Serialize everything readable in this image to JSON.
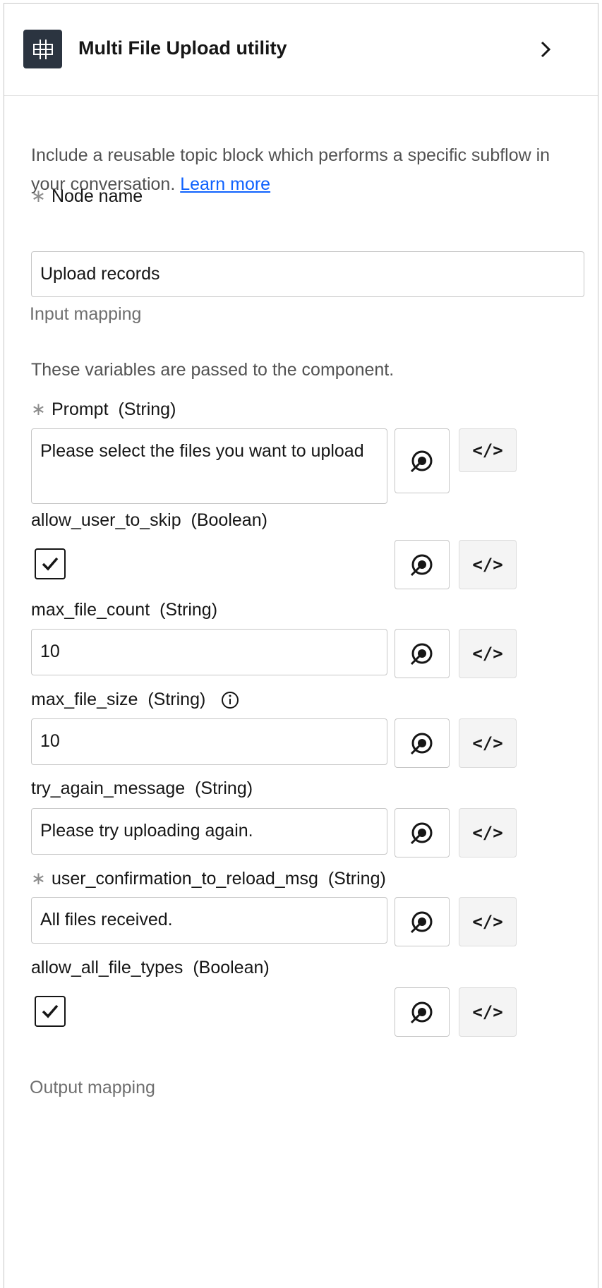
{
  "header": {
    "title": "Multi File Upload utility",
    "icon": "grid-plus-icon"
  },
  "description": {
    "text": "Include a reusable topic block which performs a specific subflow in your conversation.",
    "link": "Learn more"
  },
  "node_name": {
    "label": "Node name",
    "required_mark": "∗",
    "value": "Upload records"
  },
  "input_mapping": {
    "title": "Input mapping",
    "hint": "These variables are passed to the component.",
    "fields": [
      {
        "name": "Prompt",
        "type": "(String)",
        "required": true,
        "value": "Please select the files you want to upload"
      },
      {
        "name": "allow_user_to_skip",
        "type": "(Boolean)",
        "required": false,
        "checked": true
      },
      {
        "name": "max_file_count",
        "type": "(String)",
        "required": false,
        "value": "10"
      },
      {
        "name": "max_file_size",
        "type": "(String)",
        "required": false,
        "value": "10",
        "info_icon": "info-icon"
      },
      {
        "name": "try_again_message",
        "type": "(String)",
        "required": false,
        "value": "Please try uploading again."
      },
      {
        "name": "user_confirmation_to_reload_msg",
        "type": "(String)",
        "required": true,
        "value": "All files received."
      },
      {
        "name": "allow_all_file_types",
        "type": "(Boolean)",
        "required": false,
        "checked": true
      }
    ],
    "button_icons": {
      "variable": "target-icon",
      "code": "code-icon"
    },
    "code_label": "</>"
  },
  "output_mapping": {
    "title": "Output mapping"
  },
  "colors": {
    "header_icon_bg": "#2b3440",
    "link": "#0f62fe",
    "border": "#c6c6c6",
    "code_button_bg": "#f4f4f4"
  }
}
